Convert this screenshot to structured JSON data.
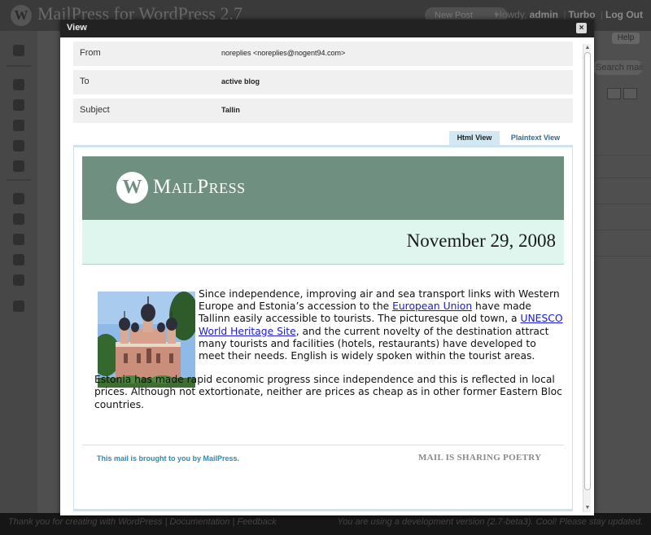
{
  "admin": {
    "site_title": "MailPress for WordPress 2.7",
    "new_post": "New Post",
    "greeting": "Howdy,",
    "username": "admin",
    "turbo": "Turbo",
    "logout": "Log Out",
    "help": "Help",
    "search_button": "Search mails",
    "footer_left": "Thank you for creating with WordPress | Documentation | Feedback",
    "footer_right": "You are using a development version (2.7-beta3). Cool! Please stay updated."
  },
  "modal": {
    "title": "View",
    "close_label": "×",
    "fields": [
      {
        "label": "From",
        "value": "noreplies <noreplies@nogent94.com>"
      },
      {
        "label": "To",
        "value": "active blog"
      },
      {
        "label": "Subject",
        "value": "Tallin"
      }
    ],
    "tabs": {
      "html": "Html View",
      "plain": "Plaintext View"
    }
  },
  "mail": {
    "logo_text": "MailPress",
    "date": "November 29, 2008",
    "p1_before_link1": "Since independence, improving air and sea transport links with Western Europe and Estonia’s accession to the ",
    "link1": "European Union",
    "p1_between_links": " have made Tallinn easily accessible to tourists. The picturesque old town, a ",
    "link2": "UNESCO World Heritage Site",
    "p1_after_link2": ", and the current novelty of the destination attract many tourists and facilities (hotels, restaurants) have developed to meet their needs. English is widely spoken within the tourist areas.",
    "p2": "Estonia has made rapid economic progress since independence and this is reflected in local prices. Although not extortionate, neither are prices as cheap as in other former Eastern Bloc countries.",
    "footer_left": "This mail is brought to you by MailPress.",
    "footer_right": "MAIL IS SHARING POETRY"
  },
  "colors": {
    "banner": "#6f9080",
    "date_band": "#dff6ef",
    "link": "#1a1ad0",
    "footer_link": "#2c8ab5",
    "tab_active": "#d2e8f3"
  }
}
